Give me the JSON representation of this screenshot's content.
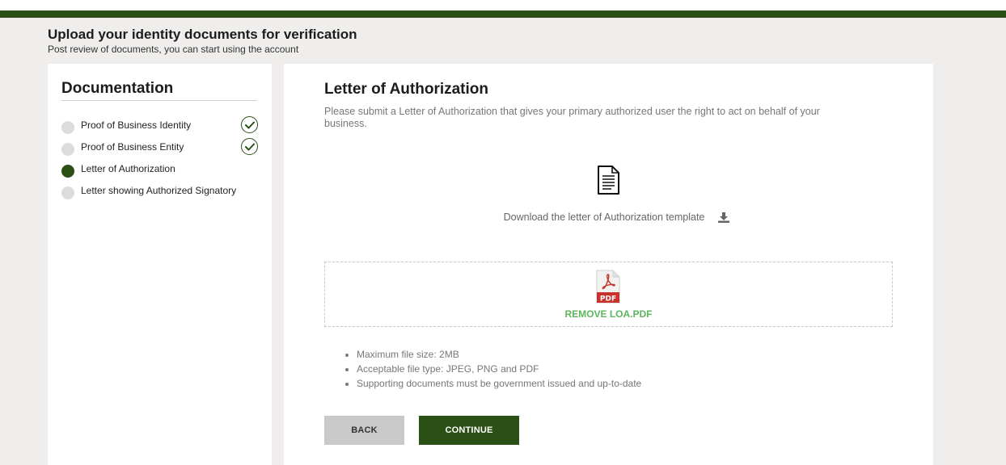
{
  "colors": {
    "brand_green": "#2b5016",
    "success_green": "#5cb65c",
    "background": "#efeeec"
  },
  "header": {
    "title": "Upload your identity documents for verification",
    "subtitle": "Post review of documents, you can start using the account"
  },
  "sidebar": {
    "title": "Documentation",
    "steps": [
      {
        "label": "Proof of Business Identity",
        "status": "completed"
      },
      {
        "label": "Proof of Business Entity",
        "status": "completed"
      },
      {
        "label": "Letter of Authorization",
        "status": "active"
      },
      {
        "label": "Letter showing Authorized Signatory",
        "status": "pending"
      }
    ]
  },
  "main": {
    "title": "Letter of Authorization",
    "description": "Please submit a Letter of Authorization that gives your primary authorized user the right to act on behalf of your business.",
    "template_icon": "document-icon",
    "download_label": "Download the letter of Authorization template",
    "download_icon": "download-icon",
    "upload": {
      "file_icon": "pdf-file-icon",
      "file_icon_text": "PDF",
      "remove_label": "REMOVE LOA.PDF"
    },
    "rules": [
      "Maximum file size: 2MB",
      "Acceptable file type: JPEG, PNG and PDF",
      "Supporting documents must be government issued and up-to-date"
    ],
    "back_label": "BACK",
    "continue_label": "CONTINUE"
  }
}
